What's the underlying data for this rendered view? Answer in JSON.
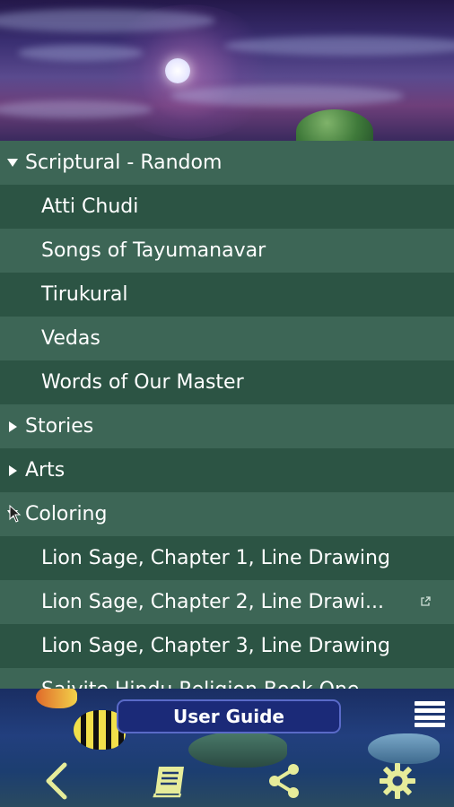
{
  "menu": {
    "sections": [
      {
        "label": "Scriptural - Random",
        "expanded": true,
        "items": [
          "Atti Chudi",
          "Songs of Tayumanavar",
          "Tirukural",
          "Vedas",
          "Words of Our Master"
        ]
      },
      {
        "label": "Stories",
        "expanded": false,
        "items": []
      },
      {
        "label": "Arts",
        "expanded": false,
        "items": []
      },
      {
        "label": "Coloring",
        "expanded": true,
        "items": [
          "Lion Sage, Chapter 1, Line Drawing",
          "Lion Sage, Chapter 2, Line Drawi...",
          "Lion Sage, Chapter 3, Line Drawing",
          "Saivite Hindu Religion Book One"
        ]
      }
    ]
  },
  "bottom_bar": {
    "user_guide_label": "User Guide",
    "tools": [
      "back-icon",
      "book-icon",
      "share-icon",
      "settings-icon"
    ]
  },
  "colors": {
    "row_dark": "#2c5444",
    "row_light": "#3d6656",
    "toolbar_icon": "#e6ec9a"
  }
}
